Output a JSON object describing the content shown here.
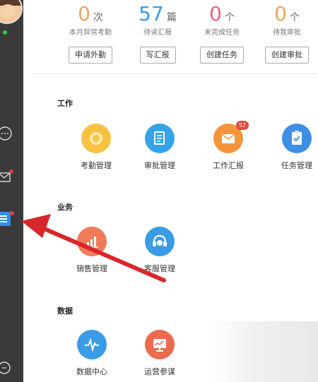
{
  "stats": [
    {
      "num": "0",
      "unit": "次",
      "label": "本月异常考勤",
      "button": "申请外勤",
      "color": "#f0a55a"
    },
    {
      "num": "57",
      "unit": "篇",
      "label": "待读汇报",
      "button": "写汇报",
      "color": "#3a9be6"
    },
    {
      "num": "0",
      "unit": "个",
      "label": "未完成任务",
      "button": "创建任务",
      "color": "#e8647a"
    },
    {
      "num": "0",
      "unit": "个",
      "label": "待我审批",
      "button": "创建审批",
      "color": "#f0a55a"
    }
  ],
  "sections": {
    "work": "工作",
    "business": "业务",
    "data": "数据"
  },
  "apps": {
    "attendance": {
      "label": "考勤管理",
      "color": "#f7c244"
    },
    "approval": {
      "label": "审批管理",
      "color": "#36a3e8"
    },
    "report": {
      "label": "工作汇报",
      "color": "#f5953a",
      "badge": "57"
    },
    "task": {
      "label": "任务管理",
      "color": "#3d8fe6"
    },
    "sales": {
      "label": "销售管理",
      "color": "#f07a5a"
    },
    "service": {
      "label": "客服管理",
      "color": "#3a9be6"
    },
    "datacenter": {
      "label": "数据中心",
      "color": "#3a9be6"
    },
    "operations": {
      "label": "运营参谋",
      "color": "#ec6b4f"
    }
  },
  "colors": {
    "sidebar": "#3a3a3a",
    "arrow": "#d9262a"
  }
}
